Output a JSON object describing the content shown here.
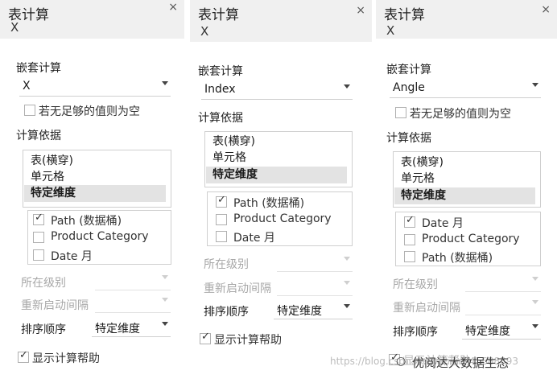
{
  "panels": [
    {
      "title": "表计算",
      "field": "X",
      "close": "×",
      "nested_label": "嵌套计算",
      "nested_value": "X",
      "empty_check_label": "若无足够的值则为空",
      "compute_label": "计算依据",
      "compute_items": [
        "表(横穿)",
        "单元格",
        "特定维度"
      ],
      "dims": [
        {
          "label": "Path (数据桶)",
          "checked": true
        },
        {
          "label": "Product Category",
          "checked": false
        },
        {
          "label": "Date 月",
          "checked": false
        }
      ],
      "level_label": "所在级别",
      "restart_label": "重新启动间隔",
      "sort_label": "排序顺序",
      "sort_value": "特定维度",
      "show_help_label": "显示计算帮助"
    },
    {
      "title": "表计算",
      "field": "X",
      "close": "×",
      "nested_label": "嵌套计算",
      "nested_value": "Index",
      "compute_label": "计算依据",
      "compute_items": [
        "表(横穿)",
        "单元格",
        "特定维度"
      ],
      "dims": [
        {
          "label": "Path (数据桶)",
          "checked": true
        },
        {
          "label": "Product Category",
          "checked": false
        },
        {
          "label": "Date 月",
          "checked": false
        }
      ],
      "level_label": "所在级别",
      "restart_label": "重新启动间隔",
      "sort_label": "排序顺序",
      "sort_value": "特定维度",
      "show_help_label": "显示计算帮助"
    },
    {
      "title": "表计算",
      "field": "X",
      "close": "×",
      "nested_label": "嵌套计算",
      "nested_value": "Angle",
      "empty_check_label": "若无足够的值则为空",
      "compute_label": "计算依据",
      "compute_items": [
        "表(横穿)",
        "单元格",
        "特定维度"
      ],
      "dims": [
        {
          "label": "Date 月",
          "checked": true
        },
        {
          "label": "Product Category",
          "checked": false
        },
        {
          "label": "Path (数据桶)",
          "checked": false
        }
      ],
      "level_label": "所在级别",
      "restart_label": "重新启动间隔",
      "sort_label": "排序顺序",
      "sort_value": "特定维度",
      "show_help_label": "显示计算帮助"
    }
  ],
  "watermark": {
    "url": "https://blog.csdn.net/weixin_45688393",
    "account": "优阅达大数据生态"
  },
  "colors": {
    "header_bg": "#f0f0f0",
    "selected_bg": "#e3e3e3",
    "border": "#cfcfcf",
    "disabled_text": "#a8a8a8"
  }
}
